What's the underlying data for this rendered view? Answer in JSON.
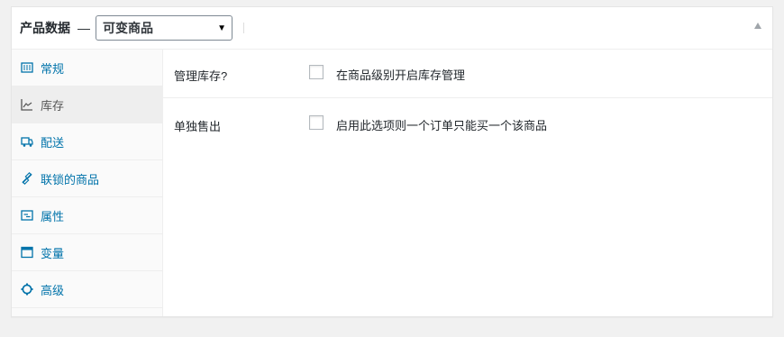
{
  "header": {
    "title": "产品数据",
    "dash": "—",
    "product_type": "可变商品",
    "select_icon": "caret-down-icon",
    "collapse_icon": "triangle-up-icon"
  },
  "sidebar": {
    "items": [
      {
        "label": "常规",
        "icon": "general-icon"
      },
      {
        "label": "库存",
        "icon": "inventory-icon",
        "active": true
      },
      {
        "label": "配送",
        "icon": "shipping-icon"
      },
      {
        "label": "联锁的商品",
        "icon": "linked-products-icon"
      },
      {
        "label": "属性",
        "icon": "attributes-icon"
      },
      {
        "label": "变量",
        "icon": "variations-icon"
      },
      {
        "label": "高级",
        "icon": "advanced-icon"
      }
    ]
  },
  "inventory": {
    "manage_stock_label": "管理库存?",
    "manage_stock_desc": "在商品级别开启库存管理",
    "manage_stock_checked": false,
    "sold_individually_label": "单独售出",
    "sold_individually_desc": "启用此选项则一个订单只能买一个该商品",
    "sold_individually_checked": false
  },
  "colors": {
    "link": "#0073aa",
    "active_bg": "#eeeeee",
    "border": "#e5e5e5"
  }
}
